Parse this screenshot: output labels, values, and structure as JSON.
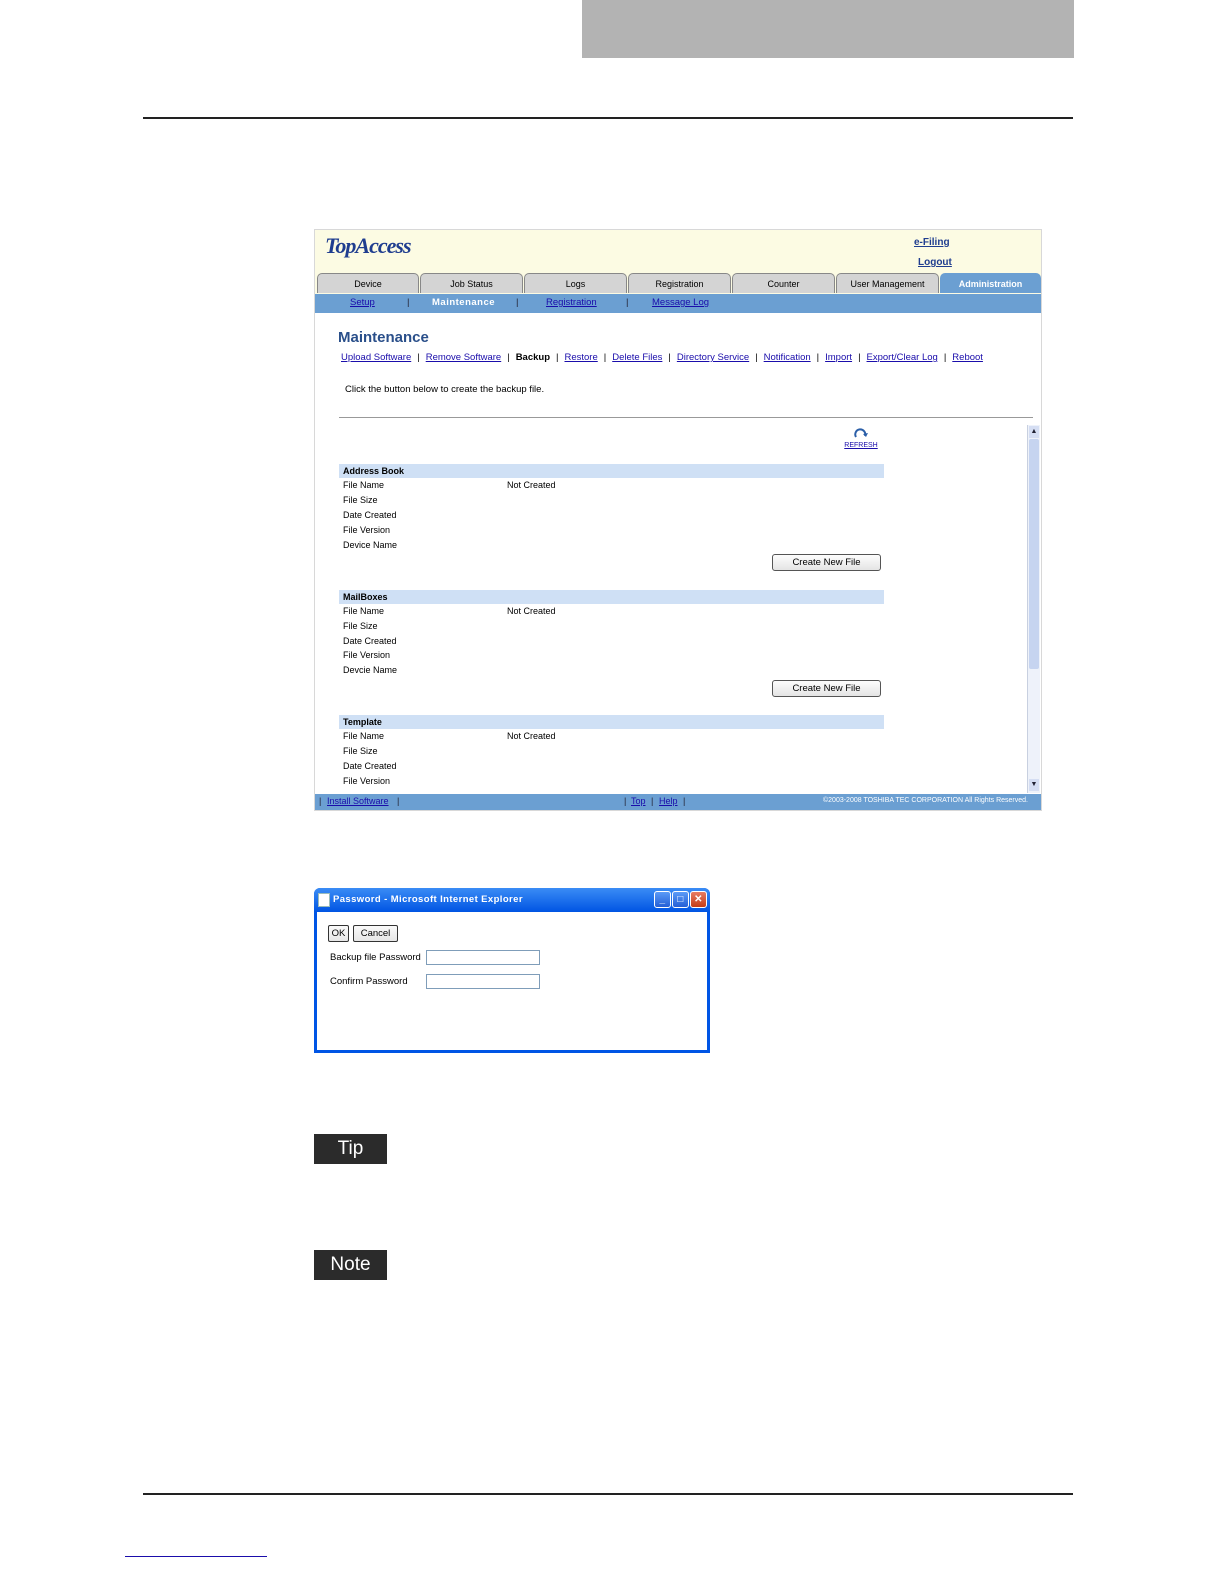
{
  "topaccess": {
    "logo": "TopAccess",
    "top_links": [
      "e-Filing",
      "Logout"
    ],
    "tabs": [
      {
        "label": "Device"
      },
      {
        "label": "Job Status"
      },
      {
        "label": "Logs"
      },
      {
        "label": "Registration"
      },
      {
        "label": "Counter"
      },
      {
        "label": "User Management"
      },
      {
        "label": "Administration",
        "active": true
      }
    ],
    "subnav": [
      {
        "label": "Setup"
      },
      {
        "label": "Maintenance",
        "active": true
      },
      {
        "label": "Registration"
      },
      {
        "label": "Message Log"
      }
    ],
    "page_title": "Maintenance",
    "maint_links": [
      {
        "label": "Upload Software"
      },
      {
        "label": "Remove Software"
      },
      {
        "label": "Backup",
        "current": true
      },
      {
        "label": "Restore"
      },
      {
        "label": "Delete Files"
      },
      {
        "label": "Directory Service"
      },
      {
        "label": "Notification"
      },
      {
        "label": "Import"
      },
      {
        "label": "Export/Clear Log"
      },
      {
        "label": "Reboot"
      }
    ],
    "instruction": "Click the button below to create the backup file.",
    "refresh_label": "REFRESH",
    "sections": [
      {
        "title": "Address Book",
        "rows": [
          "File Name",
          "File Size",
          "Date Created",
          "File Version",
          "Device Name"
        ],
        "file_name_value": "Not Created",
        "button": "Create New File"
      },
      {
        "title": "MailBoxes",
        "rows": [
          "File Name",
          "File Size",
          "Date Created",
          "File Version",
          "Devcie Name"
        ],
        "file_name_value": "Not Created",
        "button": "Create New File"
      },
      {
        "title": "Template",
        "rows": [
          "File Name",
          "File Size",
          "Date Created",
          "File Version"
        ],
        "file_name_value": "Not Created"
      }
    ],
    "footer": {
      "install": "Install Software",
      "top": "Top",
      "help": "Help",
      "copyright": "©2003-2008 TOSHIBA TEC CORPORATION All Rights Reserved."
    }
  },
  "dialog": {
    "title": "Password - Microsoft Internet Explorer",
    "ok": "OK",
    "cancel": "Cancel",
    "backup_label": "Backup file Password",
    "confirm_label": "Confirm Password",
    "backup_value": "",
    "confirm_value": ""
  },
  "tip_label": "Tip",
  "note_label": "Note"
}
